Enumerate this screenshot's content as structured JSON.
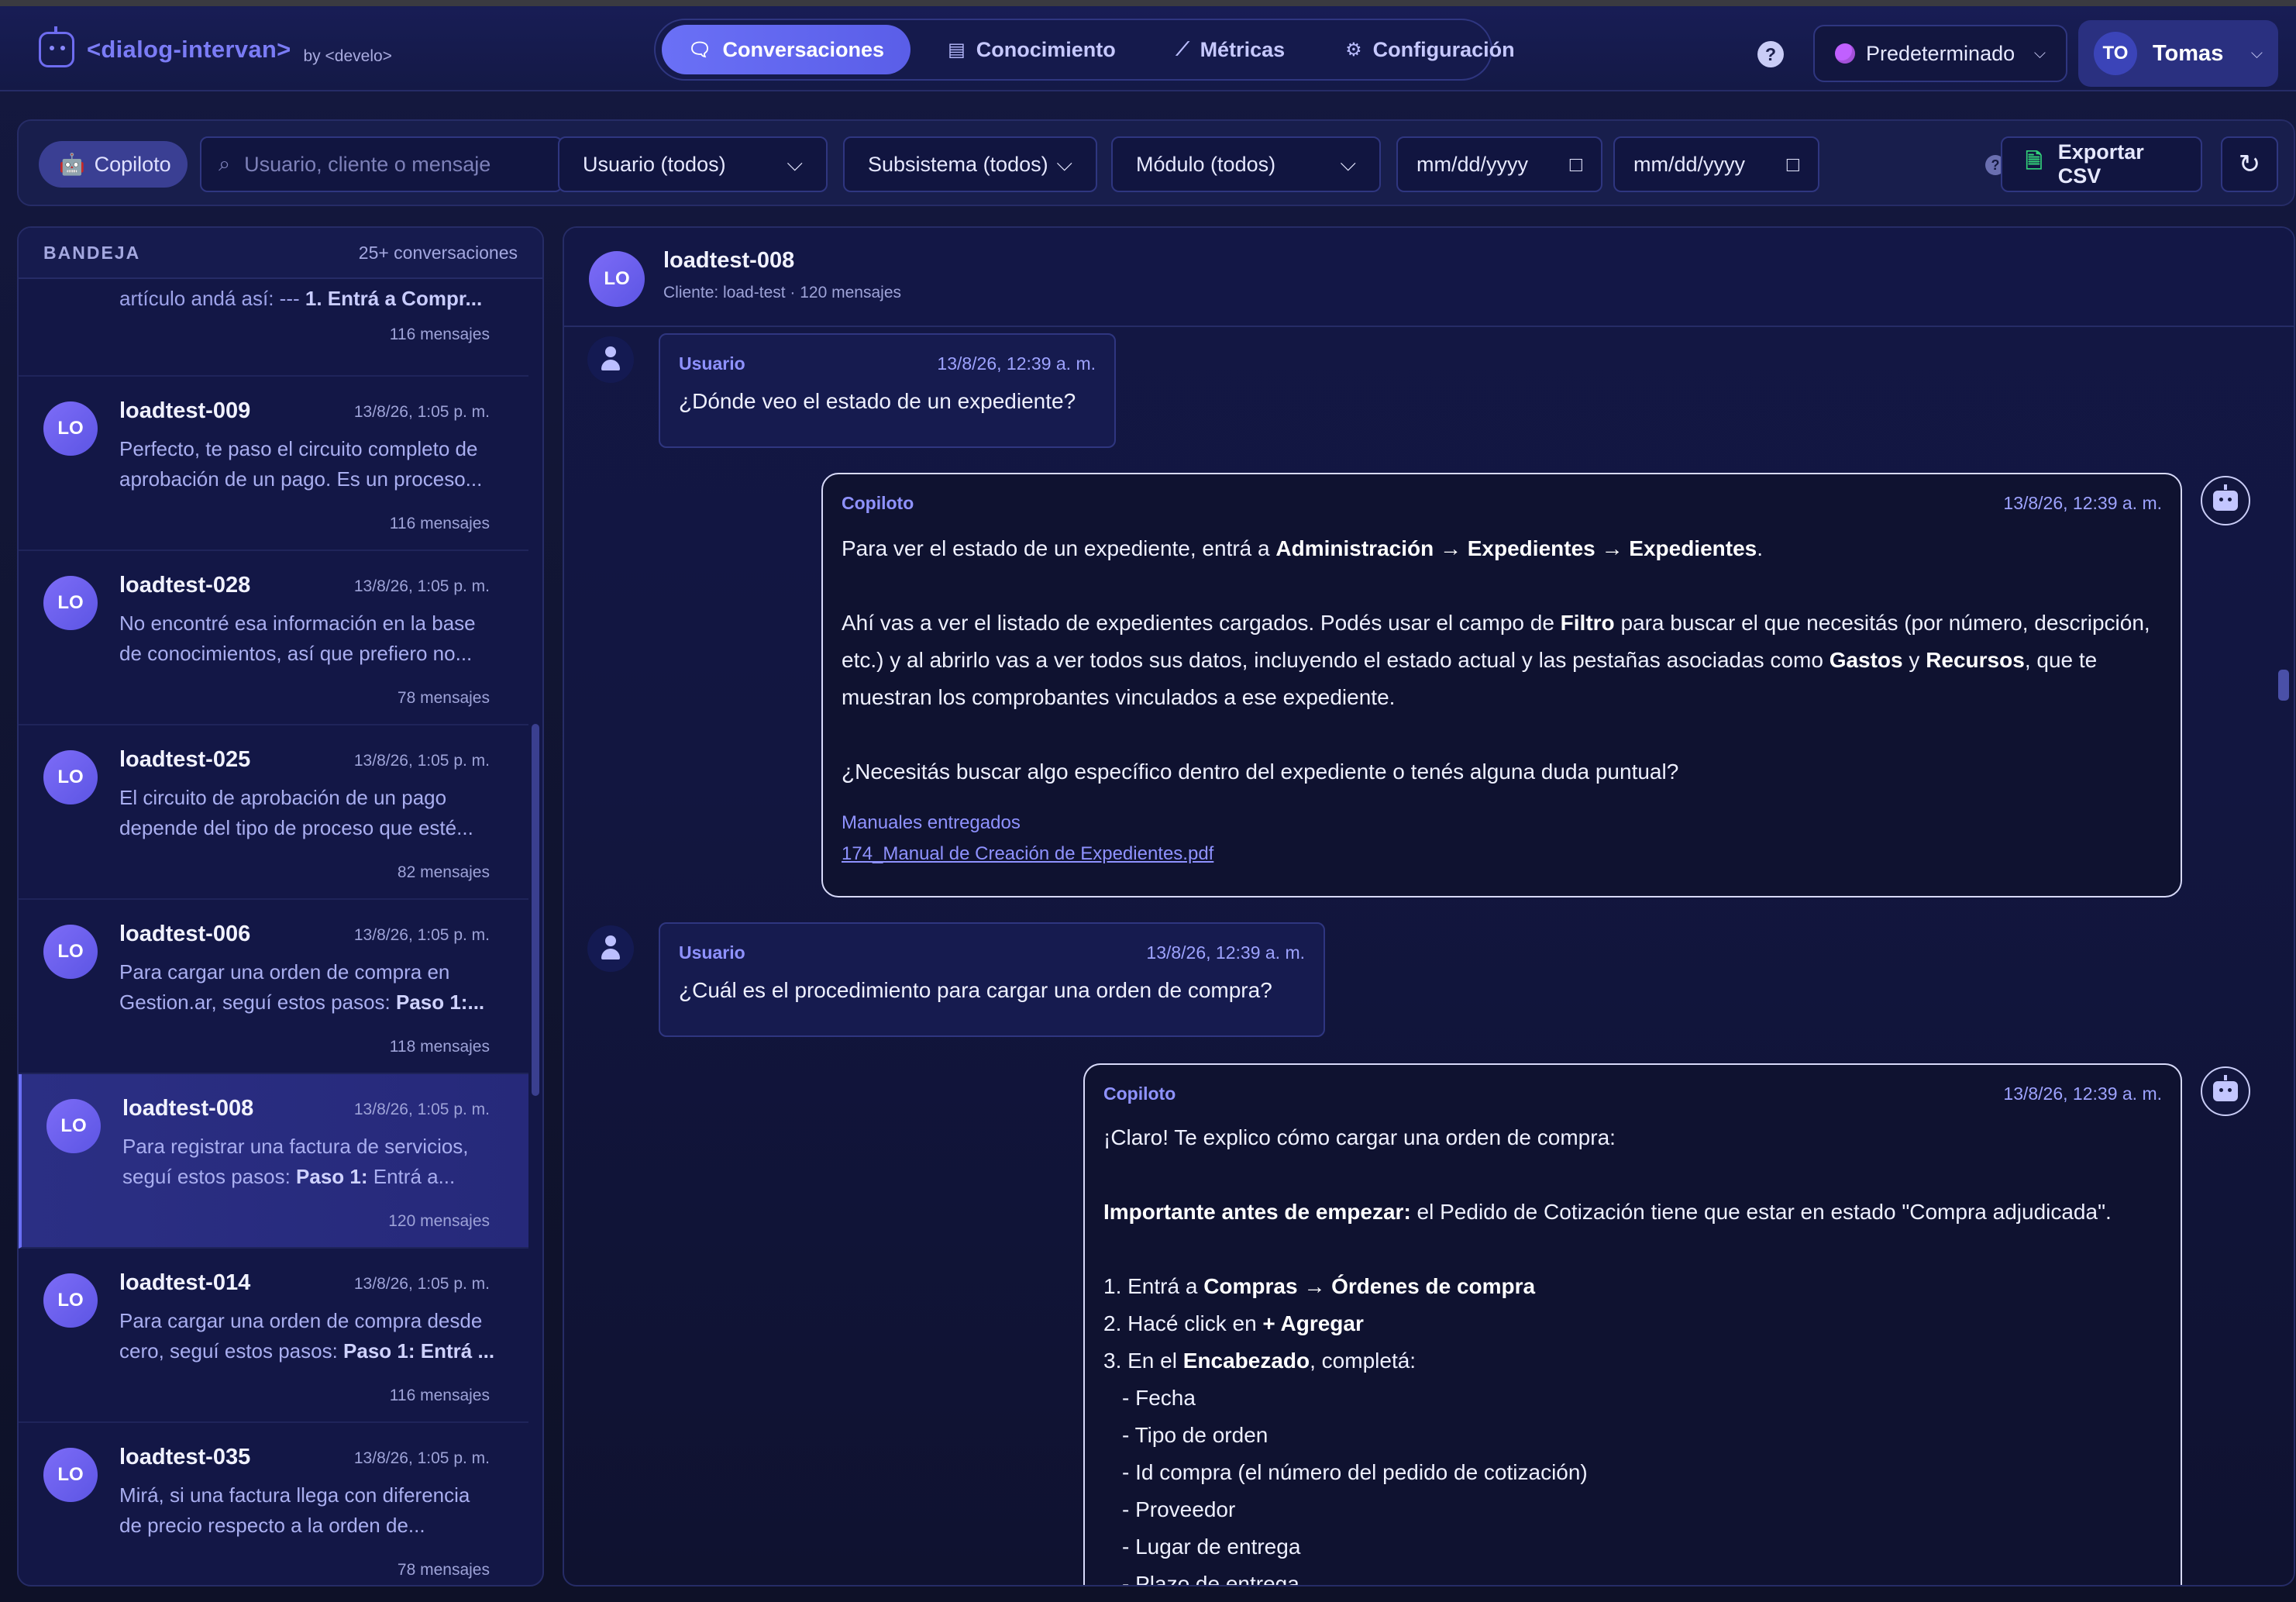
{
  "app": {
    "name": "<dialog-intervan>",
    "by": "by <develo>"
  },
  "nav": {
    "tabs": [
      {
        "label": "Conversaciones",
        "icon": "chat-icon",
        "active": true
      },
      {
        "label": "Conocimiento",
        "icon": "book-icon",
        "active": false
      },
      {
        "label": "Métricas",
        "icon": "chart-icon",
        "active": false
      },
      {
        "label": "Configuración",
        "icon": "gear-icon",
        "active": false
      }
    ]
  },
  "header": {
    "help": "?",
    "profile_label": "Predeterminado",
    "user_initials": "TO",
    "user_name": "Tomas"
  },
  "filters": {
    "copiloto_label": "Copiloto",
    "search_placeholder": "Usuario, cliente o mensaje",
    "user_select": "Usuario (todos)",
    "subsystem_select": "Subsistema (todos)",
    "module_select": "Módulo (todos)",
    "date_from": "mm/dd/yyyy",
    "date_to": "mm/dd/yyyy",
    "export_label": "Exportar CSV"
  },
  "inbox": {
    "title": "BANDEJA",
    "count": "25+ conversaciones",
    "partial": {
      "preview_prefix": "artículo andá así: --- ",
      "preview_bold": "1. Entrá a Compr...",
      "messages": "116 mensajes"
    },
    "conversations": [
      {
        "initials": "LO",
        "name": "loadtest-009",
        "time": "13/8/26, 1:05 p. m.",
        "preview_l1": "Perfecto, te paso el circuito completo de",
        "preview_l2": "aprobación de un pago. Es un proceso...",
        "messages": "116 mensajes"
      },
      {
        "initials": "LO",
        "name": "loadtest-028",
        "time": "13/8/26, 1:05 p. m.",
        "preview_l1": "No encontré esa información en la base",
        "preview_l2": "de conocimientos, así que prefiero no...",
        "messages": "78 mensajes"
      },
      {
        "initials": "LO",
        "name": "loadtest-025",
        "time": "13/8/26, 1:05 p. m.",
        "preview_l1": "El circuito de aprobación de un pago",
        "preview_l2": "depende del tipo de proceso que esté...",
        "messages": "82 mensajes"
      },
      {
        "initials": "LO",
        "name": "loadtest-006",
        "time": "13/8/26, 1:05 p. m.",
        "preview_l1": "Para cargar una orden de compra en",
        "preview_l2_plain": "Gestion.ar, seguí estos pasos: ",
        "preview_l2_bold": "Paso 1:...",
        "messages": "118 mensajes"
      },
      {
        "initials": "LO",
        "name": "loadtest-008",
        "time": "13/8/26, 1:05 p. m.",
        "preview_l1": "Para registrar una factura de servicios,",
        "preview_l2_plain": "seguí estos pasos: ",
        "preview_l2_bold": "Paso 1:",
        "preview_l2_tail": " Entrá a...",
        "messages": "120 mensajes",
        "active": true
      },
      {
        "initials": "LO",
        "name": "loadtest-014",
        "time": "13/8/26, 1:05 p. m.",
        "preview_l1": "Para cargar una orden de compra desde",
        "preview_l2_plain": "cero, seguí estos pasos: ",
        "preview_l2_bold": "Paso 1: Entrá ...",
        "messages": "116 mensajes"
      },
      {
        "initials": "LO",
        "name": "loadtest-035",
        "time": "13/8/26, 1:05 p. m.",
        "preview_l1": "Mirá, si una factura llega con diferencia",
        "preview_l2": "de precio respecto a la orden de...",
        "messages": "78 mensajes"
      }
    ]
  },
  "chat": {
    "initials": "LO",
    "name": "loadtest-008",
    "subtitle": "Cliente: load-test · 120 mensajes",
    "messages": [
      {
        "role": "Usuario",
        "time": "13/8/26, 12:39 a. m.",
        "text": "¿Dónde veo el estado de un expediente?"
      },
      {
        "role": "Copiloto",
        "time": "13/8/26, 12:39 a. m.",
        "p1_a": "Para ver el estado de un expediente, entrá a ",
        "p1_b": "Administración → Expedientes → Expedientes",
        "p1_c": ".",
        "p2_a": "Ahí vas a ver el listado de expedientes cargados. Podés usar el campo de ",
        "p2_b": "Filtro",
        "p2_c": " para buscar el que necesitás (por número, descripción, etc.) y al abrirlo vas a ver todos sus datos, incluyendo el estado actual y las pestañas asociadas como ",
        "p2_d": "Gastos",
        "p2_e": " y ",
        "p2_f": "Recursos",
        "p2_g": ", que te muestran los comprobantes vinculados a ese expediente.",
        "p3": "¿Necesitás buscar algo específico dentro del expediente o tenés alguna duda puntual?",
        "manuals_label": "Manuales entregados",
        "manual_link": "174_Manual de Creación de Expedientes.pdf"
      },
      {
        "role": "Usuario",
        "time": "13/8/26, 12:39 a. m.",
        "text": "¿Cuál es el procedimiento para cargar una orden de compra?"
      },
      {
        "role": "Copiloto",
        "time": "13/8/26, 12:39 a. m.",
        "intro": "¡Claro! Te explico cómo cargar una orden de compra:",
        "imp_b": "Importante antes de empezar:",
        "imp_t": " el Pedido de Cotización tiene que estar en estado \"Compra adjudicada\".",
        "s1_a": "1. Entrá a ",
        "s1_b": "Compras → Órdenes de compra",
        "s2_a": "2. Hacé click en ",
        "s2_b": "+ Agregar",
        "s3_a": "3. En el ",
        "s3_b": "Encabezado",
        "s3_c": ", completá:",
        "fields": [
          "- Fecha",
          "- Tipo de orden",
          "- Id compra (el número del pedido de cotización)",
          "- Proveedor",
          "- Lugar de entrega",
          "- Plazo de entrega"
        ]
      }
    ]
  }
}
